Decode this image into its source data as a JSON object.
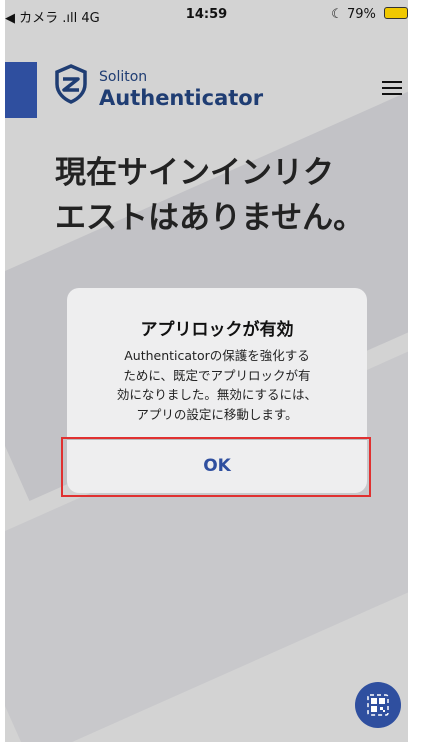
{
  "status_bar": {
    "carrier": "◀ カメラ .ıll 4G",
    "time": "14:59",
    "battery": "79%"
  },
  "header": {
    "brand_line1": "Soliton",
    "brand_line2": "Authenticator"
  },
  "main": {
    "headline_line1": "現在サインインリク",
    "headline_line2": "エストはありません。"
  },
  "dialog": {
    "title": "アプリロックが有効",
    "message_lines": [
      "Authenticatorの保護を強化する",
      "ために、既定でアプリロックが有",
      "効になりました。無効にするには、",
      "アプリの設定に移動します。"
    ],
    "ok_label": "OK"
  },
  "icons": {
    "logo": "shield-logo-icon",
    "menu": "hamburger-menu-icon",
    "qr": "qr-code-icon"
  },
  "colors": {
    "brand": "#2f4f9f",
    "background": "#d3d3d3",
    "highlight": "#e03030"
  }
}
